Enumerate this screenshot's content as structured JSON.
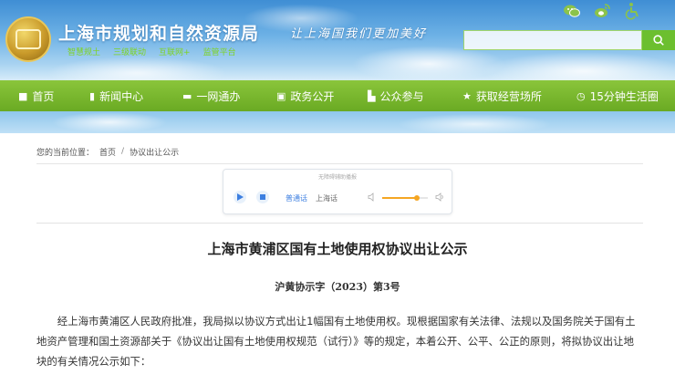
{
  "header": {
    "site_title": "上海市规划和自然资源局",
    "sub_links": [
      "智慧规土",
      "三级联动",
      "互联网+",
      "监管平台"
    ],
    "slogan": "让上海国我们更加美好",
    "icons": [
      "wechat-icon",
      "weibo-icon",
      "accessibility-icon"
    ],
    "search": {
      "placeholder": ""
    },
    "colors": {
      "accent": "#6cbf2f",
      "nav": "#78b62c"
    }
  },
  "nav": {
    "items": [
      {
        "icon": "home-icon",
        "glyph": "■",
        "label": "首页"
      },
      {
        "icon": "news-icon",
        "glyph": "▮",
        "label": "新闻中心"
      },
      {
        "icon": "service-icon",
        "glyph": "▬",
        "label": "一网通办"
      },
      {
        "icon": "gov-icon",
        "glyph": "▣",
        "label": "政务公开"
      },
      {
        "icon": "public-icon",
        "glyph": "▙",
        "label": "公众参与"
      },
      {
        "icon": "star-icon",
        "glyph": "★",
        "label": "获取经营场所"
      },
      {
        "icon": "clock-icon",
        "glyph": "◷",
        "label": "15分钟生活圈"
      }
    ]
  },
  "breadcrumb": {
    "prefix": "您的当前位置：",
    "home": "首页",
    "separator": "/",
    "current": "协议出让公示"
  },
  "player": {
    "caption": "无障碍辅助播报",
    "lang_mandarin": "普通话",
    "lang_shanghai": "上海话",
    "volume": 0.75
  },
  "article": {
    "title": "上海市黄浦区国有土地使用权协议出让公示",
    "doc_no": "沪黄协示字（2023）第3号",
    "paragraph": "经上海市黄浦区人民政府批准，我局拟以协议方式出让1幅国有土地使用权。现根据国家有关法律、法规以及国务院关于国有土地资产管理和国土资源部关于《协议出让国有土地使用权规范（试行）》等的规定，本着公开、公平、公正的原则，将拟协议出让地块的有关情况公示如下："
  }
}
